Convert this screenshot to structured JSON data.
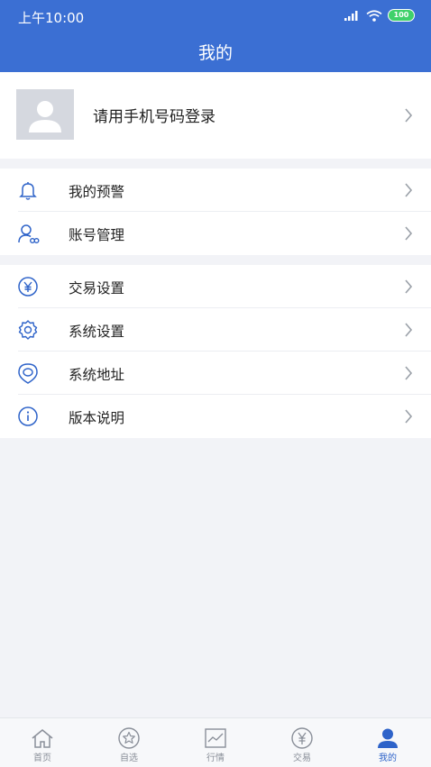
{
  "status_bar": {
    "time": "上午10:00",
    "battery": "100"
  },
  "header": {
    "title": "我的"
  },
  "profile": {
    "login_prompt": "请用手机号码登录"
  },
  "menu_group_1": [
    {
      "label": "我的预警",
      "icon": "bell-icon"
    },
    {
      "label": "账号管理",
      "icon": "account-icon"
    }
  ],
  "menu_group_2": [
    {
      "label": "交易设置",
      "icon": "yen-icon"
    },
    {
      "label": "系统设置",
      "icon": "gear-icon"
    },
    {
      "label": "系统地址",
      "icon": "location-icon"
    },
    {
      "label": "版本说明",
      "icon": "info-icon"
    }
  ],
  "tabbar": [
    {
      "label": "首页",
      "icon": "home-icon"
    },
    {
      "label": "自选",
      "icon": "star-icon"
    },
    {
      "label": "行情",
      "icon": "chart-icon"
    },
    {
      "label": "交易",
      "icon": "yen-icon"
    },
    {
      "label": "我的",
      "icon": "user-icon",
      "active": true
    }
  ],
  "colors": {
    "primary": "#3b6fd3",
    "icon_blue": "#2e63c9",
    "background": "#f2f3f7"
  }
}
